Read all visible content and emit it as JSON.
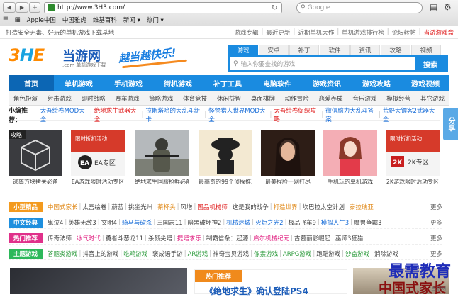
{
  "browser": {
    "url": "http://www.3H3.com/",
    "search_placeholder": "Google",
    "bookmarks": [
      "Apple中国",
      "中国雅虎",
      "维基百科",
      "新闻 ▾",
      "热门 ▾"
    ]
  },
  "topstrip": {
    "tagline": "打造安全无毒、好玩的单机游戏下载基地",
    "links": [
      "游戏专辑",
      "最近更新",
      "近期单机大作",
      "单机游戏排行榜",
      "论坛转帖"
    ],
    "hot_link": "当游游戏盒"
  },
  "logo": {
    "mark": [
      "3",
      "H",
      "E"
    ],
    "name": "当游网",
    "sub": ".com 单机游戏下载"
  },
  "slogan": "越当越快乐!",
  "search": {
    "tabs": [
      "游戏",
      "安卓",
      "补丁",
      "软件",
      "资讯",
      "攻略",
      "视频"
    ],
    "active_tab": "游戏",
    "placeholder": "输入你要查找的游戏",
    "button": "搜索"
  },
  "mainnav": [
    "首页",
    "单机游戏",
    "手机游戏",
    "街机游戏",
    "补丁工具",
    "电脑软件",
    "游戏资讯",
    "游戏攻略",
    "游戏视频"
  ],
  "subnav": [
    "角色扮演",
    "射击游戏",
    "即时战略",
    "赛车游戏",
    "策略游戏",
    "体育竞技",
    "休闲益智",
    "桌面棋牌",
    "动作冒险",
    "恋爱养成",
    "音乐游戏",
    "模拟经营",
    "其它游戏"
  ],
  "recommend": {
    "label": "小编推荐：",
    "items": [
      {
        "text": "太吾绘卷MOD大全",
        "color": "#1a6ed8"
      },
      {
        "text": "绝地求生武器大全",
        "color": "#e02020"
      },
      {
        "text": "拉斯塔哈的大乱斗新卡",
        "color": "#1a6ed8"
      },
      {
        "text": "怪物猎人世界MOD大全",
        "color": "#1a6ed8"
      },
      {
        "text": "太吾绘卷促织攻略",
        "color": "#e02020"
      },
      {
        "text": "微信脑力大乱斗答案",
        "color": "#1a6ed8"
      },
      {
        "text": "荒野大镖客2武器大全",
        "color": "#1a6ed8"
      }
    ]
  },
  "share": "分享",
  "cards": [
    {
      "caption": "逃离方块拷关必备",
      "badge": "攻略"
    },
    {
      "caption": "EA游戏限时活动专区",
      "badge": "限时折扣活动"
    },
    {
      "caption": "绝地求生国服抢鲜必备",
      "badge": ""
    },
    {
      "caption": "最高奇的99个侦探推理",
      "badge": ""
    },
    {
      "caption": "最美捏脸一网打尽",
      "badge": ""
    },
    {
      "caption": "手机玩的单机游戏",
      "badge": ""
    },
    {
      "caption": "2K游戏限时活动专区",
      "badge": "限时折扣活动"
    }
  ],
  "card_sub_labels": [
    "EA专区",
    "2K专区"
  ],
  "categories": [
    {
      "tag": "小型精品",
      "color": "#f39a1e",
      "items": [
        {
          "t": "中国式家长",
          "c": "#e08a1a"
        },
        {
          "t": "太吾绘卷",
          "c": "#444"
        },
        {
          "t": "蔚蓝",
          "c": "#444"
        },
        {
          "t": "挑坐光州",
          "c": "#444"
        },
        {
          "t": "茶杯头",
          "c": "#e08a1a"
        },
        {
          "t": "风增",
          "c": "#444"
        },
        {
          "t": "图品机械师",
          "c": "#e02020"
        },
        {
          "t": "这是我的战争",
          "c": "#444"
        },
        {
          "t": "打造世界",
          "c": "#e08a1a"
        },
        {
          "t": "坎巴拉太空计划",
          "c": "#444"
        },
        {
          "t": "泰拉瑞亚",
          "c": "#e08a1a"
        }
      ]
    },
    {
      "tag": "中文经典",
      "color": "#1e8fde",
      "items": [
        {
          "t": "鬼泣4",
          "c": "#444"
        },
        {
          "t": "英雄无敌3",
          "c": "#444"
        },
        {
          "t": "文明4",
          "c": "#444"
        },
        {
          "t": "骑马与砍杀",
          "c": "#1a6ed8"
        },
        {
          "t": "三国志11",
          "c": "#444"
        },
        {
          "t": "暗黑破坏神2",
          "c": "#444"
        },
        {
          "t": "机械迷城",
          "c": "#1a6ed8"
        },
        {
          "t": "火炬之光2",
          "c": "#1a6ed8"
        },
        {
          "t": "极品飞车9",
          "c": "#444"
        },
        {
          "t": "模拟人生3",
          "c": "#1a6ed8"
        },
        {
          "t": "魔兽争霸3",
          "c": "#444"
        }
      ]
    },
    {
      "tag": "热门推荐",
      "color": "#e0308a",
      "items": [
        {
          "t": "传奇法师",
          "c": "#444"
        },
        {
          "t": "冰气时代",
          "c": "#e02080"
        },
        {
          "t": "勇者斗恶龙11",
          "c": "#444"
        },
        {
          "t": "杀戮尖塔",
          "c": "#444"
        },
        {
          "t": "提塔求乐",
          "c": "#e02080"
        },
        {
          "t": "制霸信条：起源",
          "c": "#444"
        },
        {
          "t": "启尔机械纪元",
          "c": "#e02080"
        },
        {
          "t": "古墓丽影崛起",
          "c": "#444"
        },
        {
          "t": "巫师3狂猎",
          "c": "#444"
        }
      ]
    },
    {
      "tag": "主题游戏",
      "color": "#2cb85a",
      "items": [
        {
          "t": "答题类游戏",
          "c": "#2a9a3a"
        },
        {
          "t": "抖音上的游戏",
          "c": "#444"
        },
        {
          "t": "吃鸡游戏",
          "c": "#2a9a3a"
        },
        {
          "t": "褒成语手游",
          "c": "#444"
        },
        {
          "t": "AR游戏",
          "c": "#2a9a3a"
        },
        {
          "t": "神奇宝贝游戏",
          "c": "#444"
        },
        {
          "t": "像素游戏",
          "c": "#2a9a3a"
        },
        {
          "t": "ARPG游戏",
          "c": "#2a9a3a"
        },
        {
          "t": "跑酷游戏",
          "c": "#444"
        },
        {
          "t": "沙盒游戏",
          "c": "#2a9a3a"
        },
        {
          "t": "消除游戏",
          "c": "#444"
        }
      ]
    }
  ],
  "more": "更多",
  "bottom": {
    "hot_title": "热门推荐",
    "headline": "《绝地求生》确认登陆PS4",
    "image_text": "中国式家长"
  },
  "watermark": "最需教育",
  "watermark_small": "当游网"
}
